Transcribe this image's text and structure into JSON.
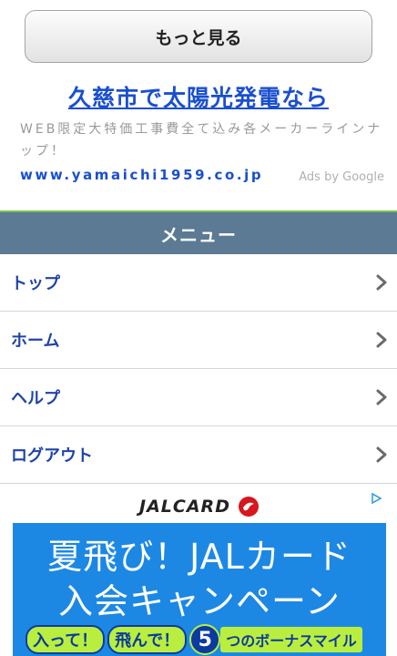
{
  "more_button": {
    "label": "もっと見る"
  },
  "ad": {
    "title": "久慈市で太陽光発電なら",
    "description": "WEB限定大特価工事費全て込み各メーカーラインナップ！",
    "url": "www.yamaichi1959.co.jp",
    "attribution": "Ads by Google"
  },
  "menu": {
    "header": "メニュー",
    "items": [
      {
        "label": "トップ"
      },
      {
        "label": "ホーム"
      },
      {
        "label": "ヘルプ"
      },
      {
        "label": "ログアウト"
      }
    ]
  },
  "banner": {
    "brand": "JALCARD",
    "line1": "夏飛び！JALカード",
    "line2": "入会キャンペーン",
    "bubble1": "入って！",
    "bubble2": "飛んで！",
    "number": "5",
    "bonus": "つのボーナスマイル"
  },
  "colors": {
    "link_blue": "#1a4fcf",
    "menu_header_bg": "#5c7a93",
    "menu_label": "#1f44a8",
    "banner_blue": "#1c88e4",
    "banner_green": "#b9ee3f",
    "jal_red": "#d7161e"
  }
}
